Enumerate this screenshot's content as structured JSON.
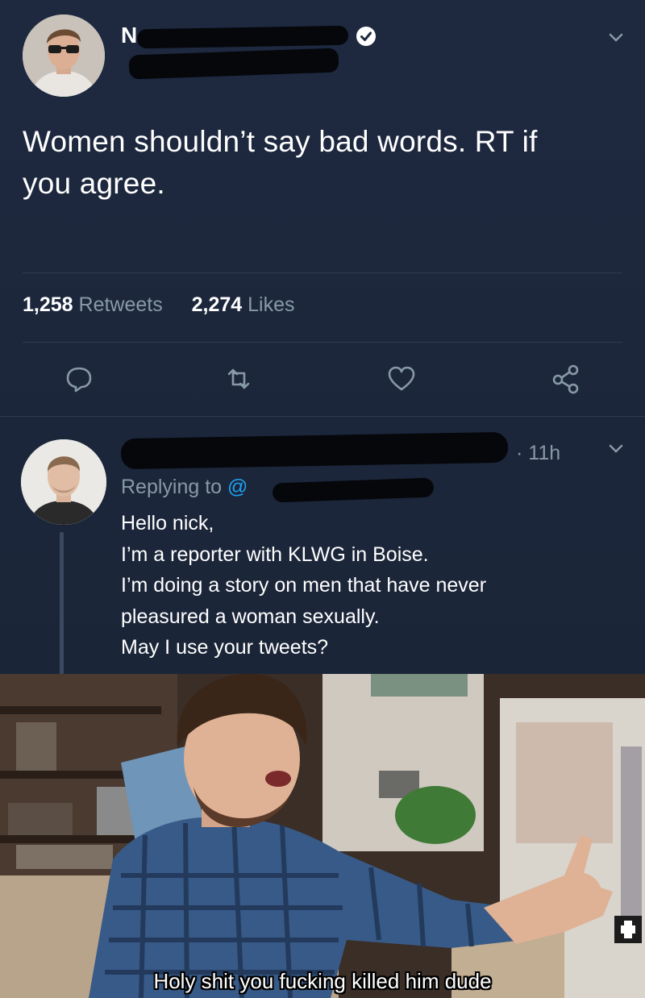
{
  "tweet": {
    "author_name_visible": "N",
    "text_line1": "Women shouldn’t say bad words. RT if",
    "text_line2": "you agree.",
    "retweets_count": "1,258",
    "retweets_label": "Retweets",
    "likes_count": "2,274",
    "likes_label": "Likes"
  },
  "reply": {
    "time": "· 11h",
    "replying_prefix": "Replying to",
    "replying_handle_visible": "@",
    "lines": [
      "Hello nick,",
      "I’m a reporter with KLWG in Boise.",
      "I’m doing a story on men that have never",
      "pleasured a woman sexually.",
      "May I use your tweets?"
    ]
  },
  "meme": {
    "caption": "Holy shit you fucking killed him dude"
  },
  "icons": [
    "verified-icon",
    "chevron-down-icon",
    "reply-icon",
    "retweet-icon",
    "like-icon",
    "share-icon"
  ],
  "colors": {
    "background": "#1e2940",
    "text_primary": "#ffffff",
    "text_secondary": "#8899a6",
    "link": "#1da1f2",
    "divider": "#2f3b52"
  }
}
